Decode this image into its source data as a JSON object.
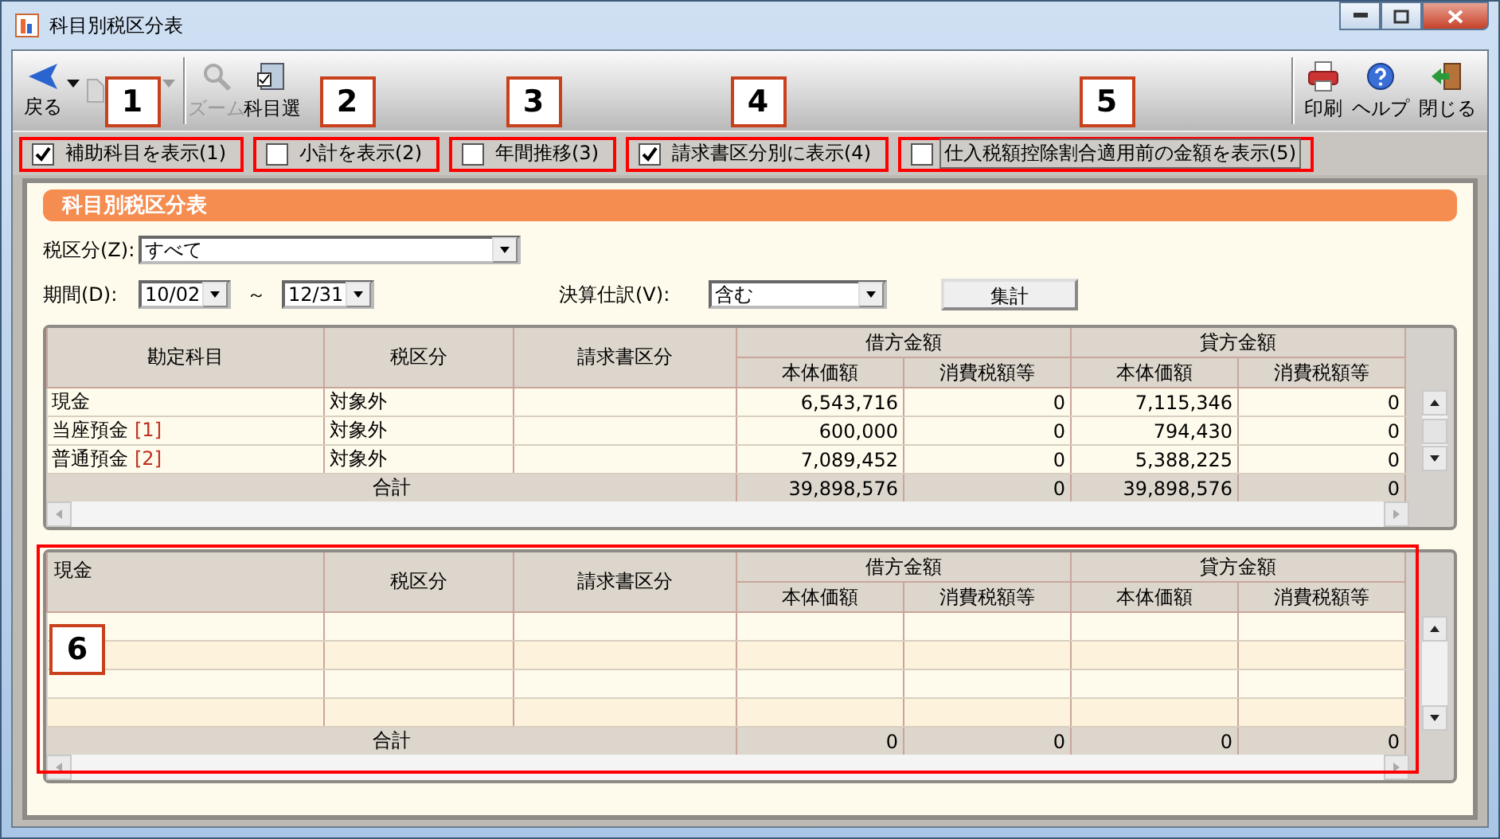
{
  "window": {
    "title": "科目別税区分表"
  },
  "toolbar": {
    "left": [
      {
        "kind": "back",
        "label": "戻る",
        "disabled": false,
        "dropdown": true
      },
      {
        "kind": "forward",
        "disabled": true,
        "dropdown": true
      },
      {
        "kind": "zoom",
        "label": "ズーム",
        "disabled": true
      },
      {
        "kind": "select",
        "label": "科目選",
        "disabled": false
      }
    ],
    "right": [
      {
        "kind": "print",
        "label": "印刷",
        "disabled": false
      },
      {
        "kind": "help",
        "label": "ヘルプ",
        "disabled": false
      },
      {
        "kind": "close",
        "label": "閉じる",
        "disabled": false
      }
    ]
  },
  "options": [
    {
      "label": "補助科目を表示(1)",
      "checked": true,
      "highlighted": true,
      "focused": false,
      "callout": "1"
    },
    {
      "label": "小計を表示(2)",
      "checked": false,
      "highlighted": true,
      "focused": false,
      "callout": "2"
    },
    {
      "label": "年間推移(3)",
      "checked": false,
      "highlighted": true,
      "focused": false,
      "callout": "3"
    },
    {
      "label": "請求書区分別に表示(4)",
      "checked": true,
      "highlighted": true,
      "focused": false,
      "callout": "4"
    },
    {
      "label": "仕入税額控除割合適用前の金額を表示(5)",
      "checked": false,
      "highlighted": true,
      "focused": true,
      "callout": "5"
    }
  ],
  "panel_title": "科目別税区分表",
  "tax_category": {
    "label": "税区分(Z):",
    "value": "すべて"
  },
  "period": {
    "label": "期間(D):",
    "from": "10/02",
    "separator": "～",
    "to": "12/31"
  },
  "closing_entries": {
    "label": "決算仕訳(V):",
    "value": "含む"
  },
  "aggregate_button": "集計",
  "table": {
    "columns": [
      "勘定科目",
      "税区分",
      "請求書区分"
    ],
    "groups": [
      "借方金額",
      "貸方金額"
    ],
    "subcolumns": [
      "本体価額",
      "消費税額等",
      "本体価額",
      "消費税額等"
    ],
    "rows": [
      {
        "account": "現金",
        "tax": "対象外",
        "amounts": [
          "6,543,716",
          "0",
          "7,115,346",
          "0"
        ]
      },
      {
        "account": "当座預金",
        "ref": "[1]",
        "tax": "対象外",
        "amounts": [
          "600,000",
          "0",
          "794,430",
          "0"
        ]
      },
      {
        "account": "普通預金",
        "ref": "[2]",
        "tax": "対象外",
        "amounts": [
          "7,089,452",
          "0",
          "5,388,225",
          "0"
        ]
      }
    ],
    "total": {
      "label": "合計",
      "amounts": [
        "39,898,576",
        "0",
        "39,898,576",
        "0"
      ]
    }
  },
  "detail_table": {
    "columns": [
      "現金",
      "税区分",
      "請求書区分"
    ],
    "groups": [
      "借方金額",
      "貸方金額"
    ],
    "subcolumns": [
      "本体価額",
      "消費税額等",
      "本体価額",
      "消費税額等"
    ],
    "total": {
      "label": "合計",
      "amounts": [
        "0",
        "0",
        "0",
        "0"
      ]
    },
    "highlighted": true,
    "callout": "6"
  }
}
